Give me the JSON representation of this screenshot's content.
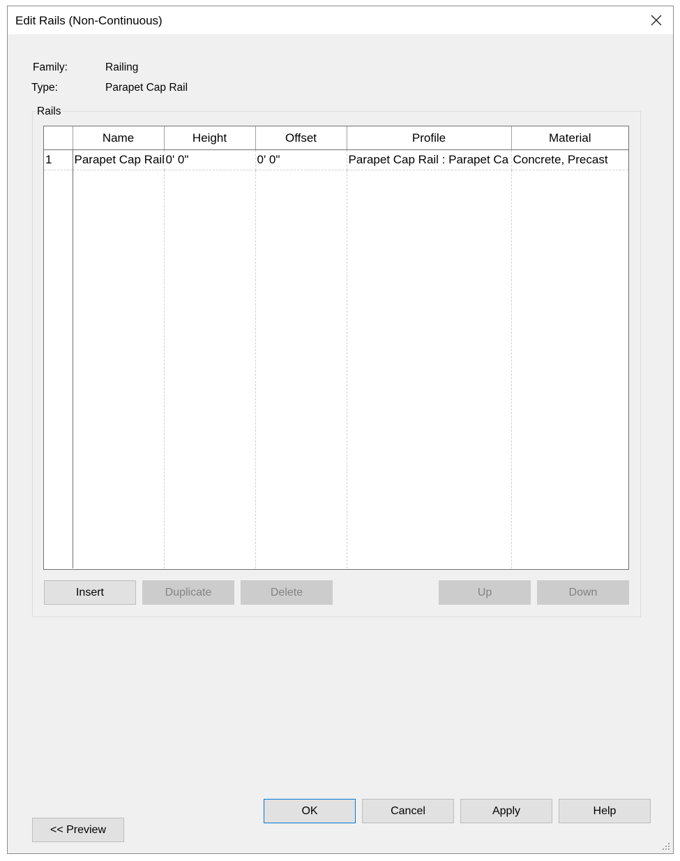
{
  "window": {
    "title": "Edit Rails (Non-Continuous)",
    "close_icon": "close-icon"
  },
  "info": {
    "family_label": "Family:",
    "family_value": "Railing",
    "type_label": "Type:",
    "type_value": "Parapet Cap Rail"
  },
  "rails": {
    "group_label": "Rails",
    "columns": [
      "",
      "Name",
      "Height",
      "Offset",
      "Profile",
      "Material"
    ],
    "rows": [
      {
        "num": "1",
        "name": "Parapet Cap Rail",
        "height": "0'  0\"",
        "offset": "0'  0\"",
        "profile": "Parapet Cap Rail : Parapet Ca",
        "material": "Concrete, Precast"
      }
    ],
    "buttons": {
      "insert": "Insert",
      "duplicate": "Duplicate",
      "delete": "Delete",
      "up": "Up",
      "down": "Down"
    }
  },
  "footer": {
    "preview": "<< Preview",
    "ok": "OK",
    "cancel": "Cancel",
    "apply": "Apply",
    "help": "Help"
  }
}
